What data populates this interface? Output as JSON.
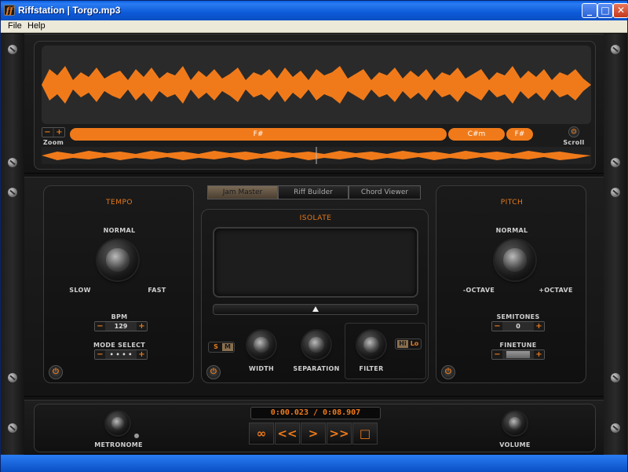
{
  "window": {
    "title": "Riffstation  |  Torgo.mp3",
    "logo": "ff",
    "minimize": "_",
    "maximize": "□",
    "close": "✕"
  },
  "menu": {
    "items": [
      "File",
      "Help"
    ]
  },
  "waveform": {
    "zoom_label": "Zoom",
    "zoom_minus": "−",
    "zoom_plus": "+",
    "scroll_label": "Scroll",
    "chords": [
      "F#",
      "C#m",
      "F#"
    ]
  },
  "tabs": [
    "Jam Master",
    "Riff Builder",
    "Chord Viewer"
  ],
  "tempo": {
    "title": "TEMPO",
    "normal": "NORMAL",
    "slow": "SLOW",
    "fast": "FAST",
    "bpm_label": "BPM",
    "bpm_value": "129",
    "mode_label": "MODE SELECT",
    "mode_value": "• • • •",
    "minus": "−",
    "plus": "+"
  },
  "isolate": {
    "title": "ISOLATE",
    "solo": "S",
    "mute": "M",
    "width_label": "WIDTH",
    "separation_label": "SEPARATION",
    "filter_label": "FILTER",
    "hi": "Hi",
    "lo": "Lo"
  },
  "pitch": {
    "title": "PITCH",
    "normal": "NORMAL",
    "minus_octave": "-OCTAVE",
    "plus_octave": "+OCTAVE",
    "semitones_label": "SEMITONES",
    "semitones_value": "0",
    "finetune_label": "FINETUNE",
    "minus": "−",
    "plus": "+"
  },
  "transport": {
    "time": "0:00.023 / 0:08.907",
    "loop": "∞",
    "rewind": "<<",
    "play": ">",
    "forward": ">>",
    "stop": "□",
    "metronome_label": "METRONOME",
    "volume_label": "VOLUME"
  },
  "colors": {
    "accent": "#f07a1a",
    "bg": "#141414"
  }
}
